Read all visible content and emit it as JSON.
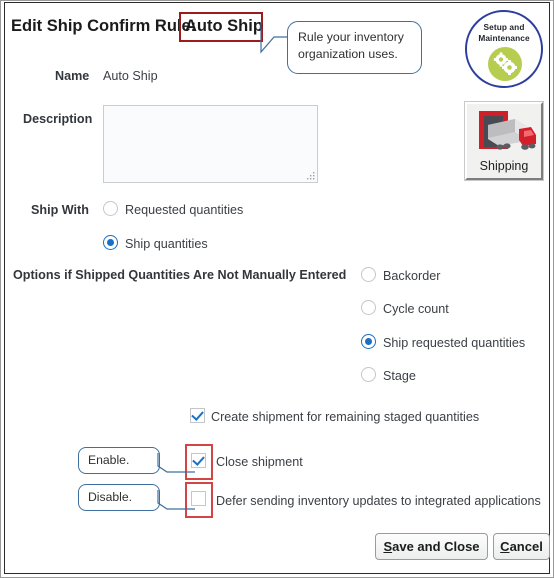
{
  "page": {
    "title_prefix": "Edit Ship Confirm Rule:",
    "title_value": "Auto Ship"
  },
  "callouts": {
    "title_note": "Rule your inventory organization uses.",
    "enable": "Enable.",
    "disable": "Disable."
  },
  "badge": {
    "line1": "Setup and",
    "line2": "Maintenance",
    "icon": "gears-icon",
    "ring_color": "#2d3e9e",
    "gear_circle_color": "#b6cd4f"
  },
  "shipping_tile": {
    "label": "Shipping",
    "icon": "truck-dock-icon"
  },
  "form": {
    "name_label": "Name",
    "name_value": "Auto Ship",
    "description_label": "Description",
    "description_value": "",
    "description_placeholder": "",
    "ship_with_label": "Ship With",
    "ship_with_options": [
      {
        "label": "Requested quantities",
        "selected": false
      },
      {
        "label": "Ship quantities",
        "selected": true
      }
    ],
    "options_label": "Options if Shipped Quantities Are Not Manually Entered",
    "options": [
      {
        "label": "Backorder",
        "selected": false
      },
      {
        "label": "Cycle count",
        "selected": false
      },
      {
        "label": "Ship requested quantities",
        "selected": true
      },
      {
        "label": "Stage",
        "selected": false
      }
    ],
    "checkboxes": [
      {
        "label": "Create shipment for remaining staged quantities",
        "checked": true,
        "highlighted": false
      },
      {
        "label": "Close shipment",
        "checked": true,
        "highlighted": true
      },
      {
        "label": "Defer sending inventory updates to integrated applications",
        "checked": false,
        "highlighted": true
      }
    ]
  },
  "buttons": {
    "save_accel": "S",
    "save_rest": "ave and Close",
    "cancel_accel": "C",
    "cancel_rest": "ancel"
  },
  "colors": {
    "accent_blue": "#1b6fc4",
    "highlight_red": "#d34545",
    "callout_border": "#3f6f9f"
  }
}
